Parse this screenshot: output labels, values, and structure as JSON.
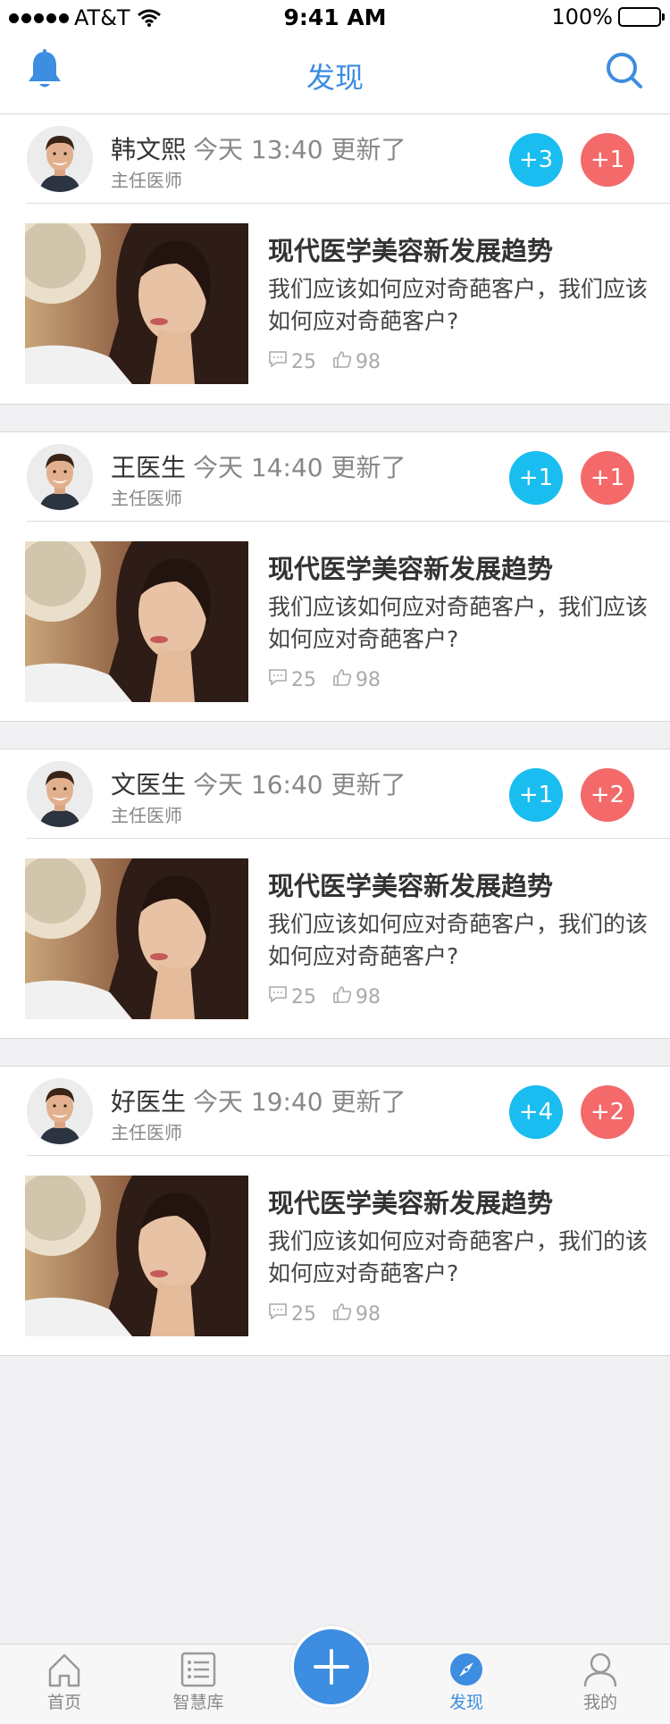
{
  "status_bar": {
    "carrier": "AT&T",
    "time": "9:41 AM",
    "battery": "100%"
  },
  "nav": {
    "title": "发现"
  },
  "colors": {
    "accent": "#3d8de0",
    "badge_blue": "#19bdf0",
    "badge_red": "#f46a6a"
  },
  "feed": [
    {
      "author": "韩文熙",
      "update": "今天 13:40 更新了",
      "role": "主任医师",
      "badge_blue": "+3",
      "badge_red": "+1",
      "article_title": "现代医学美容新发展趋势",
      "summary": "我们应该如何应对奇葩客户，我们应该如何应对奇葩客户?",
      "comments": "25",
      "likes": "98"
    },
    {
      "author": "王医生",
      "update": "今天 14:40 更新了",
      "role": "主任医师",
      "badge_blue": "+1",
      "badge_red": "+1",
      "article_title": "现代医学美容新发展趋势",
      "summary": "我们应该如何应对奇葩客户，我们应该如何应对奇葩客户?",
      "comments": "25",
      "likes": "98"
    },
    {
      "author": "文医生",
      "update": "今天 16:40 更新了",
      "role": "主任医师",
      "badge_blue": "+1",
      "badge_red": "+2",
      "article_title": "现代医学美容新发展趋势",
      "summary": "我们应该如何应对奇葩客户，我们的该如何应对奇葩客户?",
      "comments": "25",
      "likes": "98"
    },
    {
      "author": "好医生",
      "update": "今天 19:40 更新了",
      "role": "主任医师",
      "badge_blue": "+4",
      "badge_red": "+2",
      "article_title": "现代医学美容新发展趋势",
      "summary": "我们应该如何应对奇葩客户，我们的该如何应对奇葩客户?",
      "comments": "25",
      "likes": "98"
    }
  ],
  "tabs": [
    {
      "label": "首页",
      "icon": "home-icon"
    },
    {
      "label": "智慧库",
      "icon": "list-icon"
    },
    {
      "label": "发现",
      "icon": "compass-icon"
    },
    {
      "label": "我的",
      "icon": "user-icon"
    }
  ]
}
